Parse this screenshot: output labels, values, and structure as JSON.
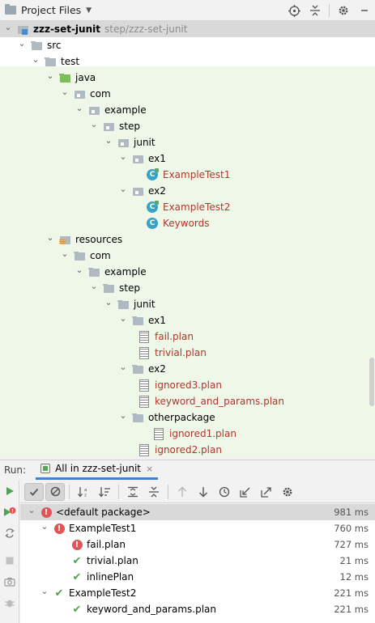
{
  "project_panel": {
    "title": "Project Files",
    "tools": {
      "locate_icon": "crosshair-icon",
      "collapse_icon": "collapse-all-icon",
      "settings_icon": "gear-icon",
      "hide_icon": "minimize-icon"
    }
  },
  "tree": [
    {
      "label": "zzz-set-junit",
      "hint": "step/zzz-set-junit",
      "icon": "module",
      "expanded": true,
      "selected": true
    },
    {
      "label": "src",
      "icon": "folder",
      "expanded": true
    },
    {
      "label": "test",
      "icon": "folder",
      "expanded": true
    },
    {
      "label": "java",
      "icon": "srcfolder",
      "expanded": true
    },
    {
      "label": "com",
      "icon": "pkg",
      "expanded": true
    },
    {
      "label": "example",
      "icon": "pkg",
      "expanded": true
    },
    {
      "label": "step",
      "icon": "pkg",
      "expanded": true
    },
    {
      "label": "junit",
      "icon": "pkg",
      "expanded": true
    },
    {
      "label": "ex1",
      "icon": "pkg",
      "expanded": true
    },
    {
      "label": "ExampleTest1",
      "icon": "class-run"
    },
    {
      "label": "ex2",
      "icon": "pkg",
      "expanded": true
    },
    {
      "label": "ExampleTest2",
      "icon": "class-run"
    },
    {
      "label": "Keywords",
      "icon": "class"
    },
    {
      "label": "resources",
      "icon": "resfolder",
      "expanded": true
    },
    {
      "label": "com",
      "icon": "folder",
      "expanded": true
    },
    {
      "label": "example",
      "icon": "folder",
      "expanded": true
    },
    {
      "label": "step",
      "icon": "folder",
      "expanded": true
    },
    {
      "label": "junit",
      "icon": "folder",
      "expanded": true
    },
    {
      "label": "ex1",
      "icon": "folder",
      "expanded": true
    },
    {
      "label": "fail.plan",
      "icon": "plan"
    },
    {
      "label": "trivial.plan",
      "icon": "plan"
    },
    {
      "label": "ex2",
      "icon": "folder",
      "expanded": true
    },
    {
      "label": "ignored3.plan",
      "icon": "plan"
    },
    {
      "label": "keyword_and_params.plan",
      "icon": "plan"
    },
    {
      "label": "otherpackage",
      "icon": "folder",
      "expanded": true
    },
    {
      "label": "ignored1.plan",
      "icon": "plan"
    },
    {
      "label": "ignored2.plan",
      "icon": "plan"
    }
  ],
  "run_panel": {
    "run_label": "Run:",
    "tab_label": "All in zzz-set-junit",
    "tab_close": "×",
    "results": [
      {
        "label": "<default package>",
        "status": "error",
        "time": "981 ms",
        "expanded": true
      },
      {
        "label": "ExampleTest1",
        "status": "error",
        "time": "760 ms",
        "expanded": true
      },
      {
        "label": "fail.plan",
        "status": "error",
        "time": "727 ms"
      },
      {
        "label": "trivial.plan",
        "status": "ok",
        "time": "21 ms"
      },
      {
        "label": "inlinePlan",
        "status": "ok",
        "time": "12 ms"
      },
      {
        "label": "ExampleTest2",
        "status": "ok",
        "time": "221 ms",
        "expanded": true
      },
      {
        "label": "keyword_and_params.plan",
        "status": "ok",
        "time": "221 ms"
      }
    ]
  }
}
